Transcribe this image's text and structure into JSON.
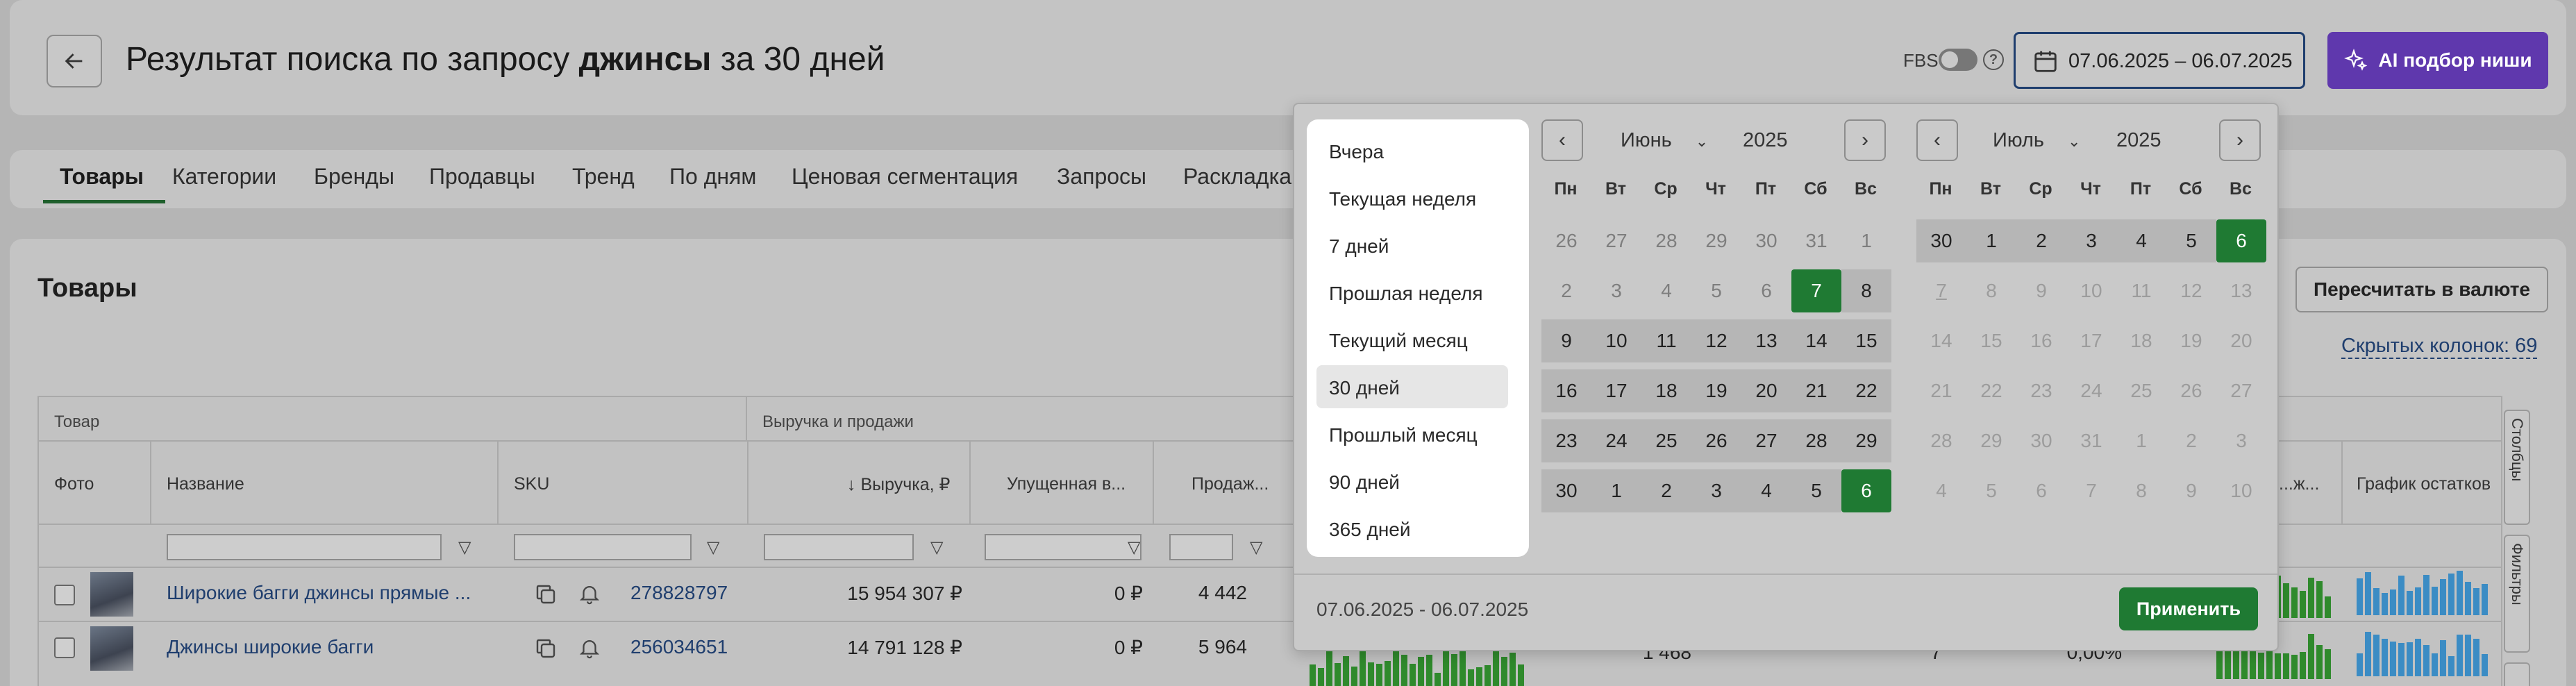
{
  "header": {
    "title_prefix": "Результат поиска по запросу ",
    "title_query": "джинсы",
    "title_suffix": " за 30 дней",
    "fbs_label": "FBS",
    "fbs_enabled": false,
    "help_glyph": "?",
    "date_range": "07.06.2025 – 06.07.2025",
    "ai_button": "AI подбор ниши",
    "colors": {
      "accent_purple": "#5f38ad",
      "accent_green": "#1f7a33",
      "link": "#1f3e6e"
    }
  },
  "tabs": [
    {
      "label": "Товары",
      "active": true
    },
    {
      "label": "Категории",
      "active": false
    },
    {
      "label": "Бренды",
      "active": false
    },
    {
      "label": "Продавцы",
      "active": false
    },
    {
      "label": "Тренд",
      "active": false
    },
    {
      "label": "По дням",
      "active": false
    },
    {
      "label": "Ценовая сегментация",
      "active": false
    },
    {
      "label": "Запросы",
      "active": false
    },
    {
      "label": "Раскладка",
      "active": false
    }
  ],
  "main": {
    "title": "Товары",
    "recalc_button": "Пересчитать в валюте",
    "hidden_columns": "Скрытых колонок: 69",
    "table": {
      "group_product": "Товар",
      "group_revenue": "Выручка и продажи",
      "columns": {
        "photo": "Фото",
        "name": "Название",
        "sku": "SKU",
        "revenue": "↓ Выручка, ₽",
        "lost": "Упущенная в...",
        "sales": "Продаж...",
        "stock_chart": "График остатков",
        "partial": "...ж..."
      },
      "rows": [
        {
          "name": "Широкие багги джинсы прямые ...",
          "sku": "278828797",
          "revenue": "15 954 307 ₽",
          "lost": "0 ₽",
          "sales": "4 442"
        },
        {
          "name": "Джинсы широкие багги",
          "sku": "256034651",
          "revenue": "14 791 128 ₽",
          "lost": "0 ₽",
          "sales": "5 964",
          "extra1": "1 468",
          "extra2": "7",
          "extra3": "0,00%"
        }
      ]
    },
    "side_tabs": {
      "columns": "Столбцы",
      "filters": "Фильтры"
    }
  },
  "date_picker": {
    "presets": [
      "Вчера",
      "Текущая неделя",
      "7 дней",
      "Прошлая неделя",
      "Текущий месяц",
      "30 дней",
      "Прошлый месяц",
      "90 дней",
      "365 дней"
    ],
    "selected_preset": "30 дней",
    "weekdays": [
      "Пн",
      "Вт",
      "Ср",
      "Чт",
      "Пт",
      "Сб",
      "Вс"
    ],
    "left": {
      "month": "Июнь",
      "year": "2025"
    },
    "right": {
      "month": "Июль",
      "year": "2025"
    },
    "range_text": "07.06.2025 - 06.07.2025",
    "apply": "Применить"
  }
}
